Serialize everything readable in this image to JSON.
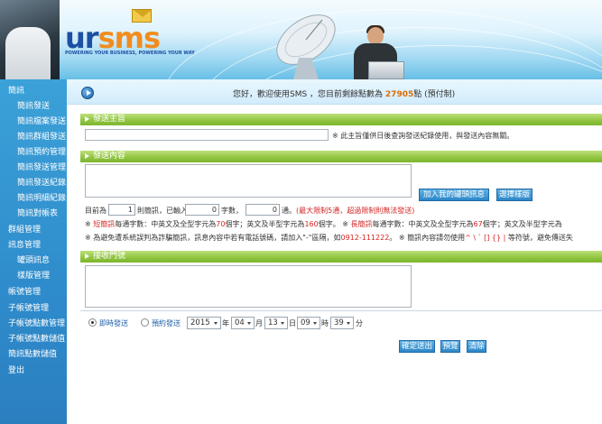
{
  "header": {
    "logo_ur": "ur",
    "logo_sms": "sms",
    "tagline": "POWERING YOUR BUSINESS, POWERING YOUR WAY"
  },
  "sidebar": {
    "items": [
      {
        "label": "簡訊",
        "level": 1
      },
      {
        "label": "簡訊發送",
        "level": 2
      },
      {
        "label": "簡訊檔案發送",
        "level": 2
      },
      {
        "label": "簡訊群組發送",
        "level": 2
      },
      {
        "label": "簡訊預約管理",
        "level": 2
      },
      {
        "label": "簡訊發送管理",
        "level": 2
      },
      {
        "label": "簡訊發送紀錄",
        "level": 2
      },
      {
        "label": "簡訊明細紀錄",
        "level": 2
      },
      {
        "label": "簡訊對帳表",
        "level": 2
      },
      {
        "label": "群組管理",
        "level": 1
      },
      {
        "label": "訊息管理",
        "level": 1
      },
      {
        "label": "罐頭訊息",
        "level": 2
      },
      {
        "label": "樣版管理",
        "level": 2
      },
      {
        "label": "帳號管理",
        "level": 1
      },
      {
        "label": "子帳號管理",
        "level": 1
      },
      {
        "label": "子帳號點數管理",
        "level": 1
      },
      {
        "label": "子帳號點數儲值",
        "level": 1
      },
      {
        "label": "簡訊點數儲值",
        "level": 1
      },
      {
        "label": "登出",
        "level": 1
      }
    ]
  },
  "topbar": {
    "welcome_prefix": "您好，歡迎使用SMS ，您目前剩餘點數為 ",
    "points": "27905",
    "welcome_suffix": "點 (預付制)"
  },
  "subject": {
    "title": "發送主旨",
    "value": "",
    "note": "※ 此主旨僅供日後查詢發送紀錄使用，與發送內容無關。"
  },
  "content": {
    "title": "發送內容",
    "value": "",
    "canned_button": "加入我的罐頭訊息",
    "template_button": "選擇樣版",
    "count_prefix": "目前為",
    "sms_count": "1",
    "count_mid1": "則簡訊，已輸入",
    "char_count": "0",
    "count_mid2": "字數，",
    "unit_count": "0",
    "count_mid3": "通。",
    "count_limit": "(最大限制5通，超過限制則無法發送)",
    "note1_a": "※ ",
    "note1_b": "短簡訊",
    "note1_c": "每通字數：中英文及全型字元為",
    "note1_d": "70",
    "note1_e": "個字；英文及半型字元為",
    "note1_f": "160",
    "note1_g": "個字。 ※ ",
    "note1_h": "長簡訊",
    "note1_i": "每通字數：中英文及全型字元為",
    "note1_j": "67",
    "note1_k": "個字；英文及半型字元為",
    "note2_a": "※ 為避免遭系統誤判為詐騙簡訊，訊息內容中若有電話號碼，請加入\"-\"區隔，如",
    "note2_b": "0912-111222",
    "note2_c": "。 ※ 簡訊內容請勿使用",
    "note2_d": "^ \\ ` [] {} |",
    "note2_e": " 等符號，避免傳送失"
  },
  "recipients": {
    "title": "接收門號",
    "value": ""
  },
  "schedule": {
    "immediate_label": "即時發送",
    "scheduled_label": "預約發送",
    "year": "2015",
    "year_unit": "年",
    "month": "04",
    "month_unit": "月",
    "day": "13",
    "day_unit": "日",
    "hour": "09",
    "hour_unit": "時",
    "minute": "39",
    "minute_unit": "分"
  },
  "actions": {
    "send": "確定送出",
    "preview": "預覽",
    "clear": "清除"
  },
  "colors": {
    "sidebar": "#2f8ccc",
    "section_bar": "#8fc43f",
    "button": "#2c86c8",
    "highlight": "#d52525",
    "points": "#e06c00"
  }
}
